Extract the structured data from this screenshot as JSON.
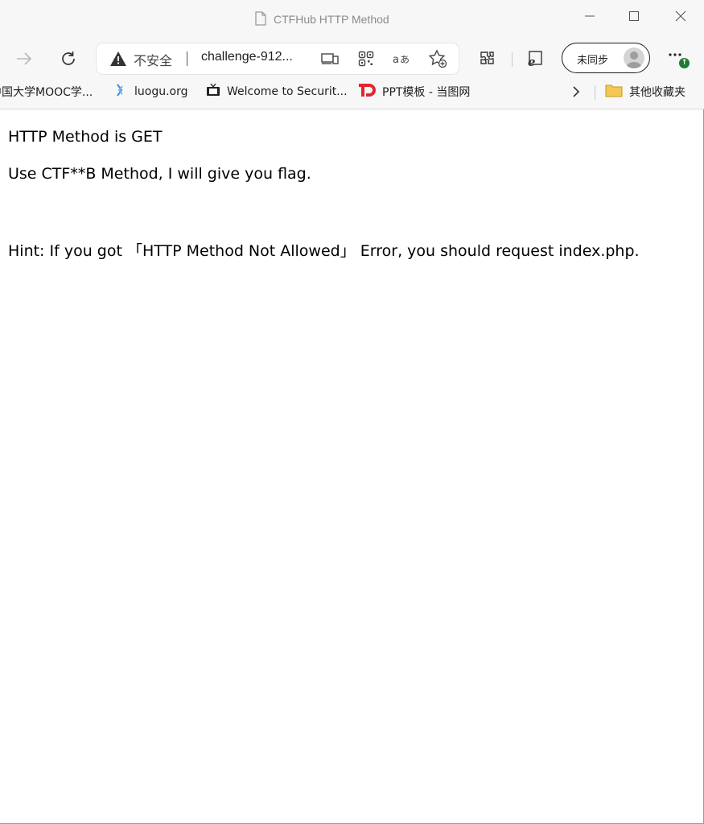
{
  "window": {
    "title": "CTFHub HTTP Method"
  },
  "toolbar": {
    "insecure_label": "不安全",
    "url": "challenge-912...",
    "sync_label": "未同步"
  },
  "favorites": {
    "items": [
      {
        "label": "中国大学MOOC学...",
        "icon": "mooc-icon"
      },
      {
        "label": "luogu.org",
        "icon": "luogu-icon"
      },
      {
        "label": "Welcome to Securit...",
        "icon": "tv-icon"
      },
      {
        "label": "PPT模板 - 当图网",
        "icon": "td-icon"
      }
    ],
    "other_label": "其他收藏夹"
  },
  "content": {
    "line1": "HTTP Method is GET",
    "line2": "Use CTF**B Method, I will give you flag.",
    "line3": "Hint: If you got 「HTTP Method Not Allowed」 Error, you should request index.php."
  },
  "colors": {
    "chrome_bg": "#f7f7f7",
    "td_red": "#e0262f",
    "update_green": "#1e7c35",
    "luogu_blue": "#3b8ee0"
  }
}
